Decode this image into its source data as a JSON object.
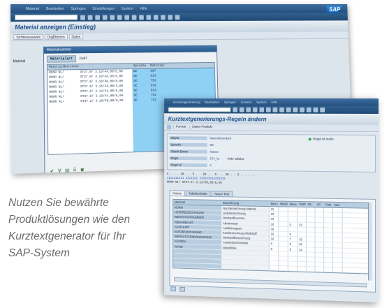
{
  "window1": {
    "menu": [
      "Material",
      "Bearbeiten",
      "Springen",
      "Einstellungen",
      "System",
      "Hilfe"
    ],
    "logo": "SAP",
    "title": "Material anzeigen (Einstieg)",
    "app_buttons": [
      "Sichtenauswahl",
      "OrgEbenen",
      "Daten"
    ],
    "side_label": "Material",
    "dialog": {
      "title": "Materialnummer",
      "tab_label": "Materialart",
      "tab_value": "FERT",
      "columns": [
        "Materialkurztext",
        "",
        "Sprache",
        "Material"
      ],
      "rows": [
        {
          "kurz": "ROHR NL/",
          "text": "ST37.0/ 3.18/44,00/5,00",
          "sprache": "DE",
          "material": "807"
        },
        {
          "kurz": "ROHR NL/",
          "text": "ST37.0/ 3.18/44,00/5,00",
          "sprache": "DE",
          "material": "813"
        },
        {
          "kurz": "ROHR NL/",
          "text": "ST37.0/ 3.18/48,00/8,00",
          "sprache": "DE",
          "material": "753"
        },
        {
          "kurz": "ROHR NL/",
          "text": "ST37.0/ 3.15/44,00/5,00",
          "sprache": "DE",
          "material": "816"
        },
        {
          "kurz": "ROHR NL/",
          "text": "ST37.0/ 3.12/54,00/5,00",
          "sprache": "DE",
          "material": "814"
        },
        {
          "kurz": "ROHR NL/",
          "text": "ST37.0/ 3.13/44,00/5,50",
          "sprache": "DE",
          "material": "791"
        },
        {
          "kurz": "ROHR NL/",
          "text": "ST37.2/ 3.18/48,00/8,00",
          "sprache": "DE",
          "material": "752"
        }
      ],
      "footer_icons": [
        "✔",
        "∀",
        "▤",
        "⌸",
        "✖"
      ]
    }
  },
  "window2": {
    "menu": [
      "Kurztextgenerierung",
      "Bearbeiten",
      "Springen",
      "Zusätze",
      "System",
      "Hilfe"
    ],
    "title": "Kurztextgenerierungs-Regeln ändern",
    "app_buttons": [
      "Format",
      "Daten Produkt"
    ],
    "header": {
      "rows": [
        {
          "k": "Objekt",
          "v": "Materialstandard",
          "v2": ""
        },
        {
          "k": "Sprache",
          "v": "DE",
          "v2": ""
        },
        {
          "k": "Objekt-Ebene",
          "v": "Klasse",
          "v2": ""
        },
        {
          "k": "Regel",
          "v": "ST1_kz",
          "v2": "Rohr nahtlos"
        },
        {
          "k": "Regel Id",
          "v": "0",
          "v2": ""
        }
      ],
      "status_text": "Regel ist maßn"
    },
    "ruler": {
      "line1": "5 . . . 10 . . 5 . . 20 . . 5 . . 30 . . 5 . . . .",
      "line2": "1111111111 2222222 333333333333333",
      "line3": "ROHR NL/        ST37.2/ 3.12/50,00/8,50"
    },
    "tabs": [
      "Klasse",
      "Tabellenfelder",
      "Neuer Text"
    ],
    "grid": {
      "columns": [
        "Merkmal",
        "Bezeichnung",
        "Max L",
        "MinDP",
        "MaxLä",
        "ToDP",
        "Pb",
        "AP",
        "Post",
        "Neu"
      ],
      "rows": [
        {
          "mk": "NORM",
          "bz": "Normbezeichnung Material",
          "c3": "10",
          "c4": "",
          "c5": "",
          "c6": "",
          "c7": "",
          "c8": "",
          "c9": "",
          "c10": ""
        },
        {
          "mk": "LIEFERBEZEICHNUNG",
          "bz": "Lieferbezeichnung",
          "c3": "10",
          "c4": "",
          "c5": "",
          "c6": "",
          "c7": "",
          "c8": "",
          "c9": "",
          "c10": ""
        },
        {
          "mk": "WERKSTOFFNUMMER",
          "bz": "Werkstoffnummer",
          "c3": "10",
          "c4": "",
          "c5": "",
          "c6": "",
          "c7": "",
          "c8": "",
          "c9": "",
          "c10": ""
        },
        {
          "mk": "ABNAHMEART",
          "bz": "Abnahmeart",
          "c3": "10",
          "c4": "",
          "c5": "5",
          "c6": "23",
          "c7": "",
          "c8": "",
          "c9": "",
          "c10": ""
        },
        {
          "mk": "AUSFUHRT",
          "bz": "Ausführungsart",
          "c3": "30",
          "c4": "",
          "c5": "",
          "c6": "",
          "c7": "",
          "c8": "",
          "c9": "",
          "c10": ""
        },
        {
          "mk": "KURZBEZEICHNUNG",
          "bz": "Kurzbezeichnung Werkstoff",
          "c3": "10",
          "c4": "",
          "c5": "6",
          "c6": "",
          "c7": "",
          "c8": "",
          "c9": "",
          "c10": ""
        },
        {
          "mk": "WERKSTOFFBEZEICHNUNG",
          "bz": "Werkstoffbezeichnung",
          "c3": "10",
          "c4": "",
          "c5": "7",
          "c6": "15",
          "c7": "",
          "c8": "",
          "c9": "",
          "c10": ""
        },
        {
          "mk": "AUSSEN",
          "bz": "Aussendurchmesser",
          "c3": "8",
          "c4": "",
          "c5": "8",
          "c6": "25",
          "c7": "",
          "c8": "",
          "c9": "",
          "c10": ""
        },
        {
          "mk": "WAND",
          "bz": "Wanddicke",
          "c3": "8",
          "c4": "",
          "c5": "9",
          "c6": "34",
          "c7": "",
          "c8": "",
          "c9": "",
          "c10": ""
        },
        {
          "mk": "",
          "bz": "",
          "c3": "",
          "c4": "",
          "c5": "",
          "c6": "",
          "c7": "",
          "c8": "",
          "c9": "",
          "c10": ""
        },
        {
          "mk": "",
          "bz": "",
          "c3": "",
          "c4": "",
          "c5": "",
          "c6": "",
          "c7": "",
          "c8": "",
          "c9": "",
          "c10": ""
        },
        {
          "mk": "",
          "bz": "",
          "c3": "",
          "c4": "",
          "c5": "",
          "c6": "",
          "c7": "",
          "c8": "",
          "c9": "",
          "c10": ""
        },
        {
          "mk": "",
          "bz": "",
          "c3": "",
          "c4": "",
          "c5": "",
          "c6": "",
          "c7": "",
          "c8": "",
          "c9": "",
          "c10": ""
        }
      ]
    }
  },
  "slogan": {
    "line1": "Nutzen Sie bewährte",
    "line2": "Produktlösungen wie den",
    "line3": "Kurztextgenerator für Ihr",
    "line4": "SAP-System"
  },
  "colors": {
    "sap_blue": "#24507f",
    "title_blue": "#1f4e8a",
    "selection_cyan": "#8fd0f5",
    "slogan_grey": "#6b6b6b"
  }
}
